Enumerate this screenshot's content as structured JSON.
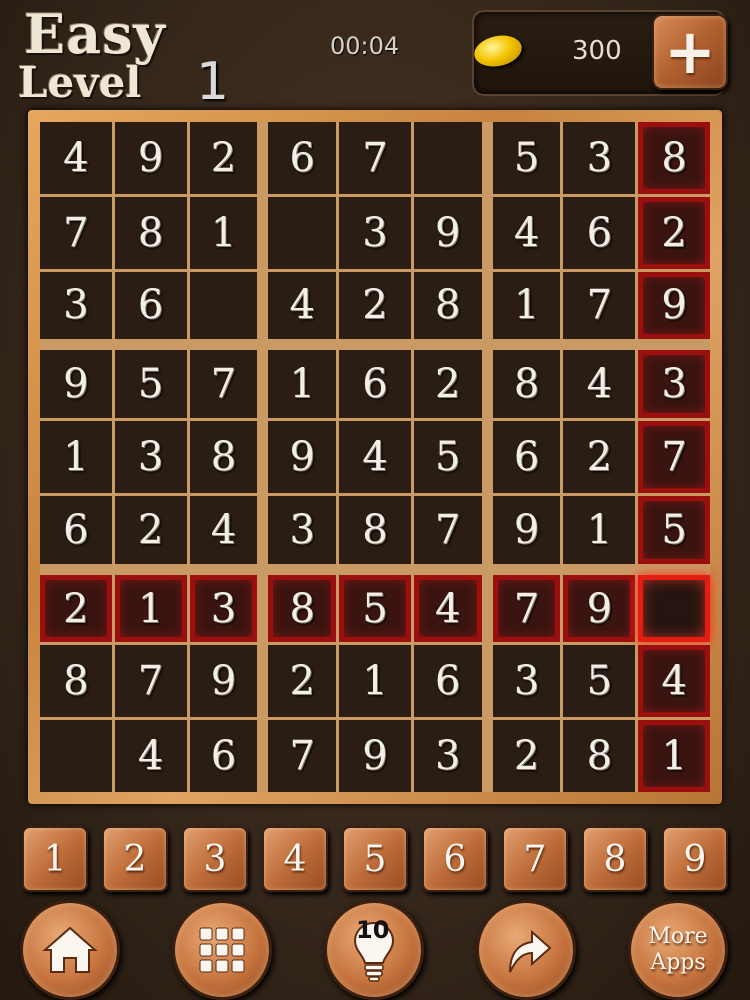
{
  "header": {
    "difficulty": "Easy",
    "level_label": "Level",
    "level_number": "1",
    "timer": "00:04",
    "coins": "300",
    "add_coins_label": "+"
  },
  "board": {
    "rows": [
      [
        "4",
        "9",
        "2",
        "6",
        "7",
        "",
        "5",
        "3",
        "8"
      ],
      [
        "7",
        "8",
        "1",
        "",
        "3",
        "9",
        "4",
        "6",
        "2"
      ],
      [
        "3",
        "6",
        "",
        "4",
        "2",
        "8",
        "1",
        "7",
        "9"
      ],
      [
        "9",
        "5",
        "7",
        "1",
        "6",
        "2",
        "8",
        "4",
        "3"
      ],
      [
        "1",
        "3",
        "8",
        "9",
        "4",
        "5",
        "6",
        "2",
        "7"
      ],
      [
        "6",
        "2",
        "4",
        "3",
        "8",
        "7",
        "9",
        "1",
        "5"
      ],
      [
        "2",
        "1",
        "3",
        "8",
        "5",
        "4",
        "7",
        "9",
        ""
      ],
      [
        "8",
        "7",
        "9",
        "2",
        "1",
        "6",
        "3",
        "5",
        "4"
      ],
      [
        "",
        "4",
        "6",
        "7",
        "9",
        "3",
        "2",
        "8",
        "1"
      ]
    ],
    "selected_row": 6,
    "selected_col": 8,
    "highlight_color": "#9b0f0f",
    "selected_color": "#e41c12"
  },
  "numpad": [
    "1",
    "2",
    "3",
    "4",
    "5",
    "6",
    "7",
    "8",
    "9"
  ],
  "bottom_bar": {
    "home_icon": "home-icon",
    "levels_icon": "grid-icon",
    "hint_icon": "lightbulb-icon",
    "hint_count": "10",
    "share_icon": "share-arrow-icon",
    "more_apps_line1": "More",
    "more_apps_line2": "Apps"
  },
  "colors": {
    "background": "#3a2a1d",
    "board_frame": "#d09050",
    "button": "#c5733d"
  }
}
